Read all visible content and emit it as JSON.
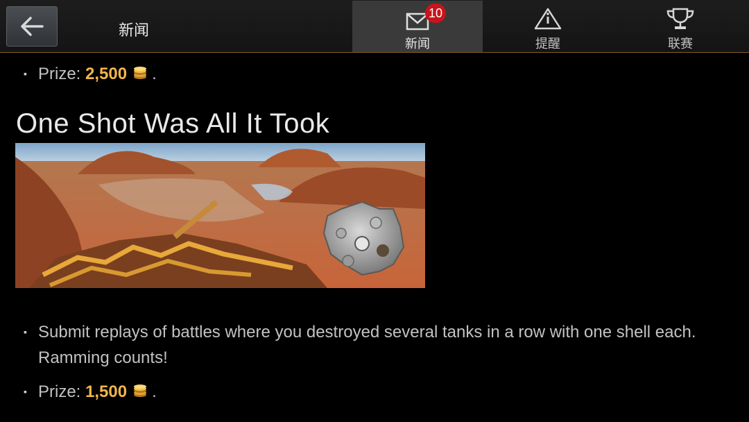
{
  "header": {
    "back_icon": "arrow-left-icon",
    "title": "新闻",
    "tabs": [
      {
        "label": "新闻",
        "icon": "envelope-icon",
        "badge": "10",
        "active": true
      },
      {
        "label": "提醒",
        "icon": "warning-triangle-icon",
        "active": false
      },
      {
        "label": "联赛",
        "icon": "trophy-icon",
        "active": false
      }
    ]
  },
  "content": {
    "top_prize": {
      "label": "Prize: ",
      "value": "2,500",
      "suffix": "."
    },
    "section_title": "One Shot Was All It Took",
    "description": "Submit replays of battles where you destroyed several tanks in a row with one shell each. Ramming counts!",
    "bottom_prize": {
      "label": "Prize: ",
      "value": "1,500",
      "suffix": "."
    },
    "coin_icon": "gold-coins-icon"
  },
  "colors": {
    "background": "#000000",
    "accent_gold": "#f2b64a",
    "badge_red": "#c8141b",
    "header_border": "#8a5a2a"
  }
}
